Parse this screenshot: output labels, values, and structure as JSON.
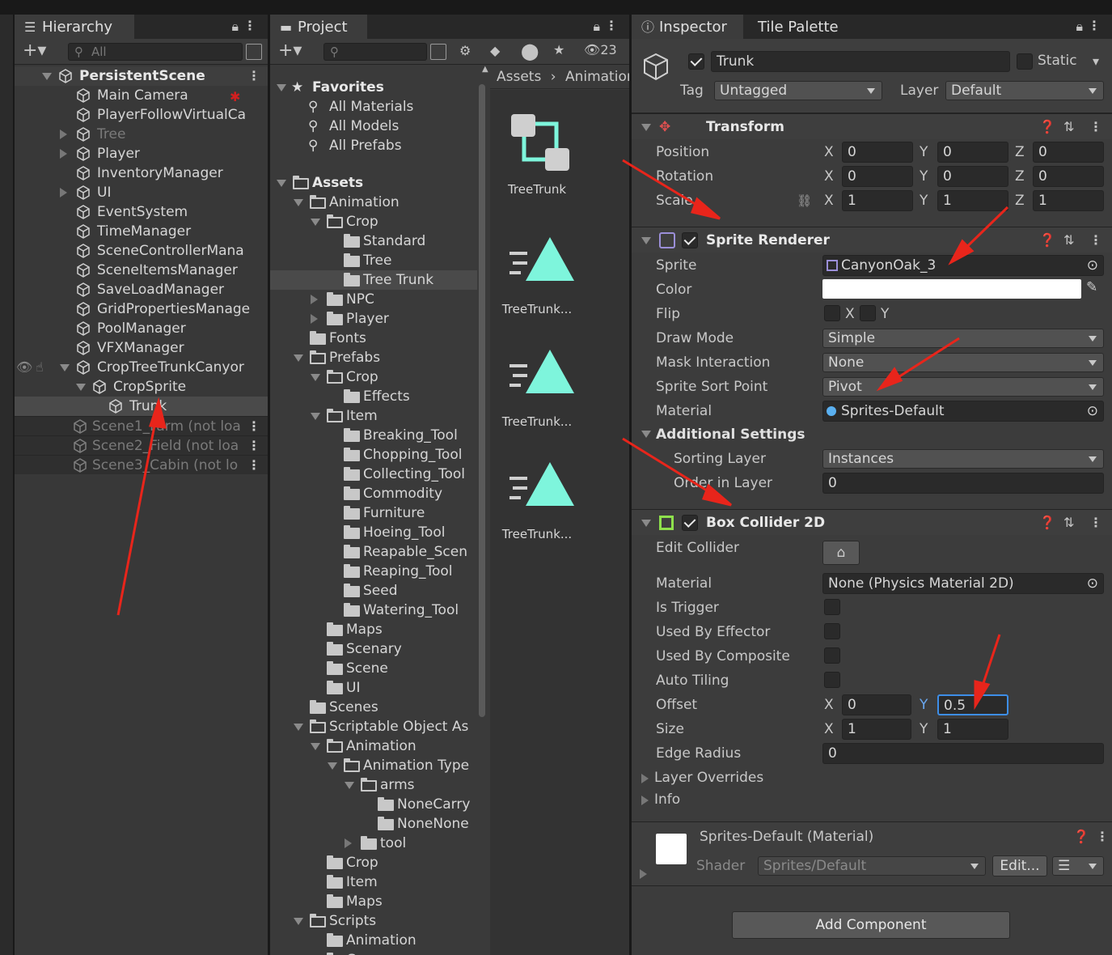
{
  "hierarchy": {
    "tab": "Hierarchy",
    "search_placeholder": "All",
    "root": "PersistentScene",
    "items": [
      "Main Camera",
      "PlayerFollowVirtualCa",
      "Tree",
      "Player",
      "InventoryManager",
      "UI",
      "EventSystem",
      "TimeManager",
      "SceneControllerMana",
      "SceneItemsManager",
      "SaveLoadManager",
      "GridPropertiesManage",
      "PoolManager",
      "VFXManager",
      "CropTreeTrunkCanyor",
      "CropSprite",
      "Trunk"
    ],
    "scenes": [
      "Scene1_Farm (not loa",
      "Scene2_Field (not loa",
      "Scene3_Cabin (not lo"
    ]
  },
  "project": {
    "tab": "Project",
    "hidden_count": "23",
    "favorites": "Favorites",
    "fav_items": [
      "All Materials",
      "All Models",
      "All Prefabs"
    ],
    "assets": "Assets",
    "tree": [
      "Animation",
      "Crop",
      "Standard",
      "Tree",
      "Tree Trunk",
      "NPC",
      "Player",
      "Fonts",
      "Prefabs",
      "Crop",
      "Effects",
      "Item",
      "Breaking_Tool",
      "Chopping_Tool",
      "Collecting_Tool",
      "Commodity",
      "Furniture",
      "Hoeing_Tool",
      "Reapable_Scen",
      "Reaping_Tool",
      "Seed",
      "Watering_Tool",
      "Maps",
      "Scenary",
      "Scene",
      "UI",
      "Scenes",
      "Scriptable Object As",
      "Animation",
      "Animation Type",
      "arms",
      "NoneCarry",
      "NoneNone",
      "tool",
      "Crop",
      "Item",
      "Maps",
      "Scripts",
      "Animation",
      "Crop"
    ],
    "breadcrumb": [
      "Assets",
      "Animation"
    ],
    "files": [
      "TreeTrunk",
      "TreeTrunk...",
      "TreeTrunk...",
      "TreeTrunk..."
    ]
  },
  "inspector": {
    "tabs": [
      "Inspector",
      "Tile Palette"
    ],
    "object_name": "Trunk",
    "static_label": "Static",
    "tag_label": "Tag",
    "tag_value": "Untagged",
    "layer_label": "Layer",
    "layer_value": "Default",
    "transform": {
      "title": "Transform",
      "rows": [
        {
          "label": "Position",
          "x": "0",
          "y": "0",
          "z": "0"
        },
        {
          "label": "Rotation",
          "x": "0",
          "y": "0",
          "z": "0"
        },
        {
          "label": "Scale",
          "x": "1",
          "y": "1",
          "z": "1"
        }
      ]
    },
    "sprite_renderer": {
      "title": "Sprite Renderer",
      "sprite_label": "Sprite",
      "sprite_value": "CanyonOak_3",
      "color_label": "Color",
      "flip_label": "Flip",
      "flip_x": "X",
      "flip_y": "Y",
      "draw_mode_label": "Draw Mode",
      "draw_mode_value": "Simple",
      "mask_label": "Mask Interaction",
      "mask_value": "None",
      "sort_point_label": "Sprite Sort Point",
      "sort_point_value": "Pivot",
      "material_label": "Material",
      "material_value": "Sprites-Default",
      "additional": "Additional Settings",
      "sorting_layer_label": "Sorting Layer",
      "sorting_layer_value": "Instances",
      "order_label": "Order in Layer",
      "order_value": "0"
    },
    "box_collider": {
      "title": "Box Collider 2D",
      "edit_label": "Edit Collider",
      "material_label": "Material",
      "material_value": "None (Physics Material 2D)",
      "trigger_label": "Is Trigger",
      "effector_label": "Used By Effector",
      "composite_label": "Used By Composite",
      "tiling_label": "Auto Tiling",
      "offset_label": "Offset",
      "offset_x": "0",
      "offset_y": "0.5",
      "size_label": "Size",
      "size_x": "1",
      "size_y": "1",
      "edge_label": "Edge Radius",
      "edge_value": "0",
      "layer_overrides": "Layer Overrides",
      "info": "Info"
    },
    "material": {
      "title": "Sprites-Default (Material)",
      "shader_label": "Shader",
      "shader_value": "Sprites/Default",
      "edit_label": "Edit..."
    },
    "add_component": "Add Component",
    "axis": {
      "x": "X",
      "y": "Y",
      "z": "Z"
    }
  },
  "colors": {
    "annotation": "#e8251b",
    "teal": "#7ef5dc"
  }
}
